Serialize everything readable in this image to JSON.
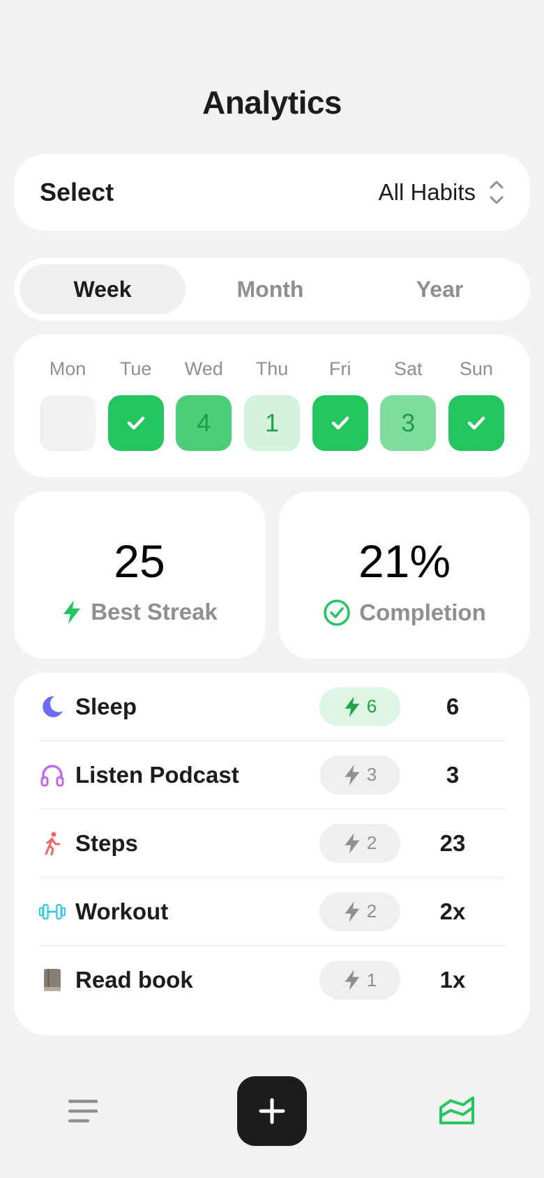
{
  "header": {
    "title": "Analytics"
  },
  "select": {
    "label": "Select",
    "value": "All Habits"
  },
  "periods": [
    {
      "label": "Week",
      "active": true
    },
    {
      "label": "Month",
      "active": false
    },
    {
      "label": "Year",
      "active": false
    }
  ],
  "week": {
    "days": [
      "Mon",
      "Tue",
      "Wed",
      "Thu",
      "Fri",
      "Sat",
      "Sun"
    ],
    "cells": [
      {
        "state": "empty",
        "text": ""
      },
      {
        "state": "done",
        "text": ""
      },
      {
        "state": "partial",
        "text": "4"
      },
      {
        "state": "partial",
        "text": "1"
      },
      {
        "state": "done",
        "text": ""
      },
      {
        "state": "partial",
        "text": "3"
      },
      {
        "state": "done",
        "text": ""
      }
    ]
  },
  "stats": {
    "best_streak": {
      "value": "25",
      "label": "Best Streak"
    },
    "completion": {
      "value": "21%",
      "label": "Completion"
    }
  },
  "habits": [
    {
      "icon": "moon-icon",
      "name": "Sleep",
      "streak": "6",
      "count": "6",
      "active": true,
      "color": "#6e6af5"
    },
    {
      "icon": "headphones-icon",
      "name": "Listen Podcast",
      "streak": "3",
      "count": "3",
      "active": false,
      "color": "#c069f0"
    },
    {
      "icon": "walking-icon",
      "name": "Steps",
      "streak": "2",
      "count": "23",
      "active": false,
      "color": "#f06666"
    },
    {
      "icon": "dumbbell-icon",
      "name": "Workout",
      "streak": "2",
      "count": "2x",
      "active": false,
      "color": "#33c9e0"
    },
    {
      "icon": "book-icon",
      "name": "Read book",
      "streak": "1",
      "count": "1x",
      "active": false,
      "color": "#8a7f74"
    }
  ],
  "colors": {
    "accent": "#22c55e",
    "background": "#f2f2f2",
    "dark": "#1c1c1e"
  }
}
